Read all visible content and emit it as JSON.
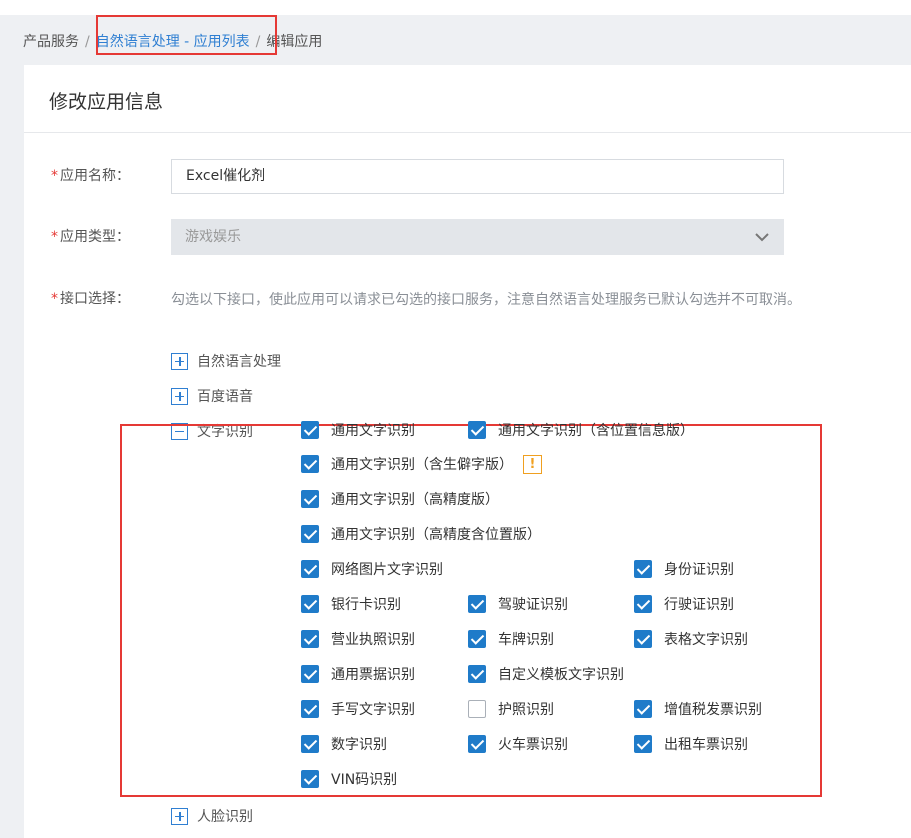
{
  "breadcrumb": {
    "item1": "产品服务",
    "sep": "/",
    "item2": "自然语言处理 - 应用列表",
    "item3": "编辑应用"
  },
  "page": {
    "title": "修改应用信息"
  },
  "form": {
    "name_label": "应用名称：",
    "name_value": "Excel催化剂",
    "type_label": "应用类型：",
    "type_value": "游戏娱乐",
    "api_label": "接口选择：",
    "api_hint": "勾选以下接口，使此应用可以请求已勾选的接口服务，注意自然语言处理服务已默认勾选并不可取消。",
    "required_mark": "*"
  },
  "groups": {
    "nlp": "自然语言处理",
    "speech": "百度语音",
    "ocr": "文字识别",
    "face": "人脸识别"
  },
  "ocr_items": [
    {
      "label": "通用文字识别",
      "checked": true
    },
    {
      "label": "通用文字识别（含位置信息版）",
      "checked": true
    },
    {
      "label": "通用文字识别（含生僻字版）",
      "checked": true
    },
    {
      "label": "通用文字识别（高精度版）",
      "checked": true
    },
    {
      "label": "通用文字识别（高精度含位置版）",
      "checked": true
    },
    {
      "label": "网络图片文字识别",
      "checked": true
    },
    {
      "label": "身份证识别",
      "checked": true
    },
    {
      "label": "银行卡识别",
      "checked": true
    },
    {
      "label": "驾驶证识别",
      "checked": true
    },
    {
      "label": "行驶证识别",
      "checked": true
    },
    {
      "label": "营业执照识别",
      "checked": true
    },
    {
      "label": "车牌识别",
      "checked": true
    },
    {
      "label": "表格文字识别",
      "checked": true
    },
    {
      "label": "通用票据识别",
      "checked": true
    },
    {
      "label": "自定义模板文字识别",
      "checked": true
    },
    {
      "label": "手写文字识别",
      "checked": true
    },
    {
      "label": "护照识别",
      "checked": false
    },
    {
      "label": "增值税发票识别",
      "checked": true
    },
    {
      "label": "数字识别",
      "checked": true
    },
    {
      "label": "火车票识别",
      "checked": true
    },
    {
      "label": "出租车票识别",
      "checked": true
    },
    {
      "label": "VIN码识别",
      "checked": true
    }
  ],
  "warning_mark": "!",
  "colors": {
    "accent": "#1f7bc9",
    "highlight": "#e53935",
    "warning": "#f0a020"
  }
}
